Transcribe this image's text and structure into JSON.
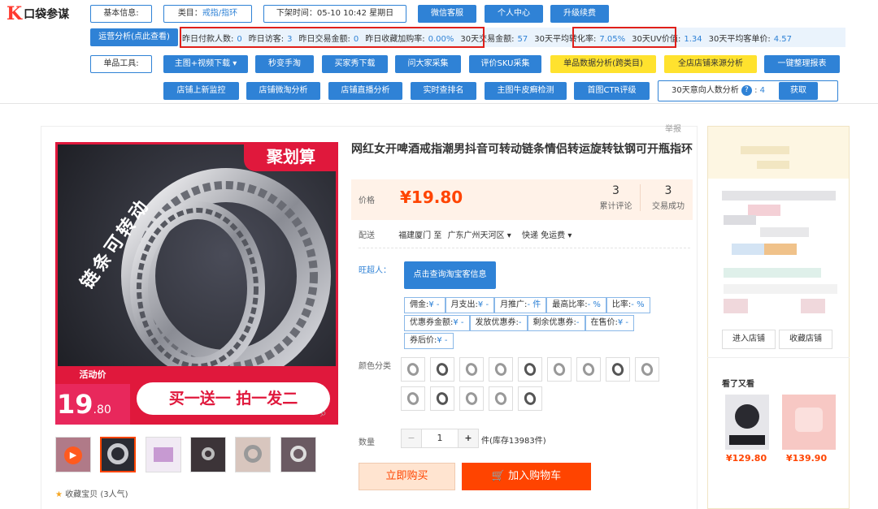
{
  "toolbar": {
    "logo_mark": "K",
    "logo_text": "口袋参谋",
    "basic_info_label": "基本信息:",
    "category_prefix": "类目：",
    "category_value": "戒指/指环",
    "delist_label": "下架时间：05-10 10:42 星期日",
    "wechat_service": "微信客服",
    "personal_center": "个人中心",
    "upgrade": "升级续费",
    "ops_analysis": "运营分析(点此查看)",
    "stats": [
      {
        "label": "昨日付款人数:",
        "value": "0"
      },
      {
        "label": "昨日访客:",
        "value": "3"
      },
      {
        "label": "昨日交易金额:",
        "value": "0"
      },
      {
        "label": "昨日收藏加购率:",
        "value": "0.00%"
      },
      {
        "label": "30天交易金额:",
        "value": "57"
      },
      {
        "label": "30天平均转化率:",
        "value": "7.05%"
      },
      {
        "label": "30天UV价值:",
        "value": "1.34"
      },
      {
        "label": "30天平均客单价:",
        "value": "4.57"
      }
    ],
    "single_tools_label": "单品工具:",
    "row3": [
      "主图+视频下载 ▾",
      "秒变手淘",
      "买家秀下载",
      "问大家采集",
      "评价SKU采集"
    ],
    "row3_yellow": [
      "单品数据分析(跨类目)",
      "全店店铺来源分析"
    ],
    "row3_last": "一键整理报表",
    "row4": [
      "店铺上新监控",
      "店铺微淘分析",
      "店铺直播分析",
      "实时查排名",
      "主图牛皮癣检测",
      "首图CTR评级"
    ],
    "intent_label": "30天意向人数分析",
    "intent_value": "4",
    "fetch": "获取"
  },
  "report": "举报",
  "product": {
    "title": "网红女开啤酒戒指潮男抖音可转动链条情侣转运旋转钛钢可开瓶指环",
    "price_label": "价格",
    "price": "¥19.80",
    "reviews_count": "3",
    "reviews_label": "累计评论",
    "deals_count": "3",
    "deals_label": "交易成功",
    "ship_label": "配送",
    "ship_from": "福建厦门 至",
    "ship_to": "广东广州天河区",
    "ship_method": "快递 免运费",
    "wangchaoren_label": "旺超人：",
    "query_button": "点击查询淘宝客信息",
    "coupons": [
      [
        "佣金:",
        "¥ -"
      ],
      [
        "月支出:",
        "¥ -"
      ],
      [
        "月推广:",
        "- 件"
      ],
      [
        "最高比率:",
        "- %"
      ],
      [
        "比率:",
        "- %"
      ],
      [
        "优惠券金额:",
        "¥ -"
      ],
      [
        "发放优惠券:",
        "-"
      ],
      [
        "剩余优惠券:",
        "-"
      ],
      [
        "在售价:",
        "¥ -"
      ],
      [
        "券后价:",
        "¥ -"
      ]
    ],
    "color_label": "颜色分类",
    "qty_label": "数量",
    "qty_value": "1",
    "stock": "件(库存13983件)",
    "buy_now": "立即购买",
    "add_cart": "加入购物车",
    "favorite": "收藏宝贝 (3人气)"
  },
  "image": {
    "brand_badge": "聚划算",
    "curve_text": "链条可转动",
    "activity_label": "活动价",
    "price_big": "19",
    "price_small": ".80",
    "promo": "买一送一 拍一发二"
  },
  "sidebar": {
    "enter_shop": "进入店铺",
    "fav_shop": "收藏店铺",
    "also_viewed": "看了又看",
    "items": [
      {
        "price": "¥129.80"
      },
      {
        "price": "¥139.90"
      }
    ]
  },
  "colors": {
    "accent": "#2f82d6",
    "red": "#e0201a",
    "orange": "#ff4400",
    "yellow": "#ffe22e"
  }
}
